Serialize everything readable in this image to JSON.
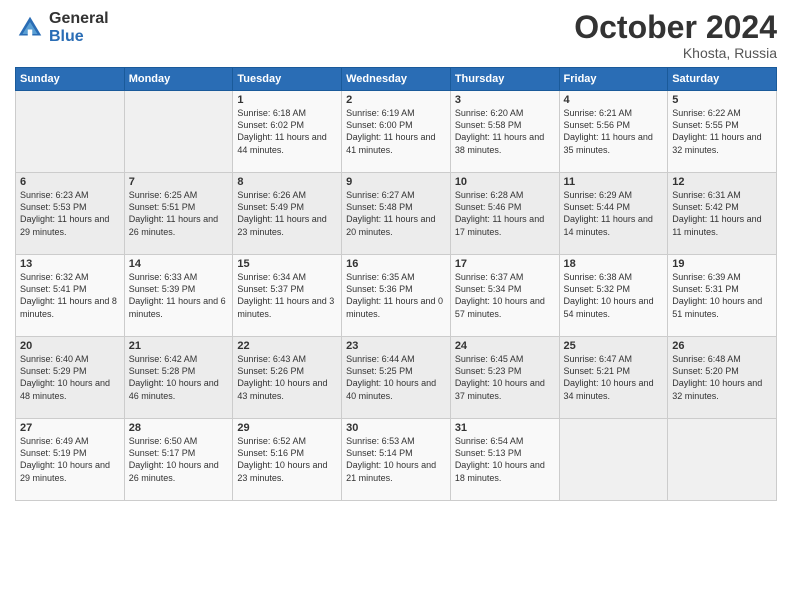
{
  "header": {
    "logo_general": "General",
    "logo_blue": "Blue",
    "month_title": "October 2024",
    "location": "Khosta, Russia"
  },
  "days_of_week": [
    "Sunday",
    "Monday",
    "Tuesday",
    "Wednesday",
    "Thursday",
    "Friday",
    "Saturday"
  ],
  "weeks": [
    [
      {
        "day": "",
        "info": ""
      },
      {
        "day": "",
        "info": ""
      },
      {
        "day": "1",
        "info": "Sunrise: 6:18 AM\nSunset: 6:02 PM\nDaylight: 11 hours and 44 minutes."
      },
      {
        "day": "2",
        "info": "Sunrise: 6:19 AM\nSunset: 6:00 PM\nDaylight: 11 hours and 41 minutes."
      },
      {
        "day": "3",
        "info": "Sunrise: 6:20 AM\nSunset: 5:58 PM\nDaylight: 11 hours and 38 minutes."
      },
      {
        "day": "4",
        "info": "Sunrise: 6:21 AM\nSunset: 5:56 PM\nDaylight: 11 hours and 35 minutes."
      },
      {
        "day": "5",
        "info": "Sunrise: 6:22 AM\nSunset: 5:55 PM\nDaylight: 11 hours and 32 minutes."
      }
    ],
    [
      {
        "day": "6",
        "info": "Sunrise: 6:23 AM\nSunset: 5:53 PM\nDaylight: 11 hours and 29 minutes."
      },
      {
        "day": "7",
        "info": "Sunrise: 6:25 AM\nSunset: 5:51 PM\nDaylight: 11 hours and 26 minutes."
      },
      {
        "day": "8",
        "info": "Sunrise: 6:26 AM\nSunset: 5:49 PM\nDaylight: 11 hours and 23 minutes."
      },
      {
        "day": "9",
        "info": "Sunrise: 6:27 AM\nSunset: 5:48 PM\nDaylight: 11 hours and 20 minutes."
      },
      {
        "day": "10",
        "info": "Sunrise: 6:28 AM\nSunset: 5:46 PM\nDaylight: 11 hours and 17 minutes."
      },
      {
        "day": "11",
        "info": "Sunrise: 6:29 AM\nSunset: 5:44 PM\nDaylight: 11 hours and 14 minutes."
      },
      {
        "day": "12",
        "info": "Sunrise: 6:31 AM\nSunset: 5:42 PM\nDaylight: 11 hours and 11 minutes."
      }
    ],
    [
      {
        "day": "13",
        "info": "Sunrise: 6:32 AM\nSunset: 5:41 PM\nDaylight: 11 hours and 8 minutes."
      },
      {
        "day": "14",
        "info": "Sunrise: 6:33 AM\nSunset: 5:39 PM\nDaylight: 11 hours and 6 minutes."
      },
      {
        "day": "15",
        "info": "Sunrise: 6:34 AM\nSunset: 5:37 PM\nDaylight: 11 hours and 3 minutes."
      },
      {
        "day": "16",
        "info": "Sunrise: 6:35 AM\nSunset: 5:36 PM\nDaylight: 11 hours and 0 minutes."
      },
      {
        "day": "17",
        "info": "Sunrise: 6:37 AM\nSunset: 5:34 PM\nDaylight: 10 hours and 57 minutes."
      },
      {
        "day": "18",
        "info": "Sunrise: 6:38 AM\nSunset: 5:32 PM\nDaylight: 10 hours and 54 minutes."
      },
      {
        "day": "19",
        "info": "Sunrise: 6:39 AM\nSunset: 5:31 PM\nDaylight: 10 hours and 51 minutes."
      }
    ],
    [
      {
        "day": "20",
        "info": "Sunrise: 6:40 AM\nSunset: 5:29 PM\nDaylight: 10 hours and 48 minutes."
      },
      {
        "day": "21",
        "info": "Sunrise: 6:42 AM\nSunset: 5:28 PM\nDaylight: 10 hours and 46 minutes."
      },
      {
        "day": "22",
        "info": "Sunrise: 6:43 AM\nSunset: 5:26 PM\nDaylight: 10 hours and 43 minutes."
      },
      {
        "day": "23",
        "info": "Sunrise: 6:44 AM\nSunset: 5:25 PM\nDaylight: 10 hours and 40 minutes."
      },
      {
        "day": "24",
        "info": "Sunrise: 6:45 AM\nSunset: 5:23 PM\nDaylight: 10 hours and 37 minutes."
      },
      {
        "day": "25",
        "info": "Sunrise: 6:47 AM\nSunset: 5:21 PM\nDaylight: 10 hours and 34 minutes."
      },
      {
        "day": "26",
        "info": "Sunrise: 6:48 AM\nSunset: 5:20 PM\nDaylight: 10 hours and 32 minutes."
      }
    ],
    [
      {
        "day": "27",
        "info": "Sunrise: 6:49 AM\nSunset: 5:19 PM\nDaylight: 10 hours and 29 minutes."
      },
      {
        "day": "28",
        "info": "Sunrise: 6:50 AM\nSunset: 5:17 PM\nDaylight: 10 hours and 26 minutes."
      },
      {
        "day": "29",
        "info": "Sunrise: 6:52 AM\nSunset: 5:16 PM\nDaylight: 10 hours and 23 minutes."
      },
      {
        "day": "30",
        "info": "Sunrise: 6:53 AM\nSunset: 5:14 PM\nDaylight: 10 hours and 21 minutes."
      },
      {
        "day": "31",
        "info": "Sunrise: 6:54 AM\nSunset: 5:13 PM\nDaylight: 10 hours and 18 minutes."
      },
      {
        "day": "",
        "info": ""
      },
      {
        "day": "",
        "info": ""
      }
    ]
  ]
}
